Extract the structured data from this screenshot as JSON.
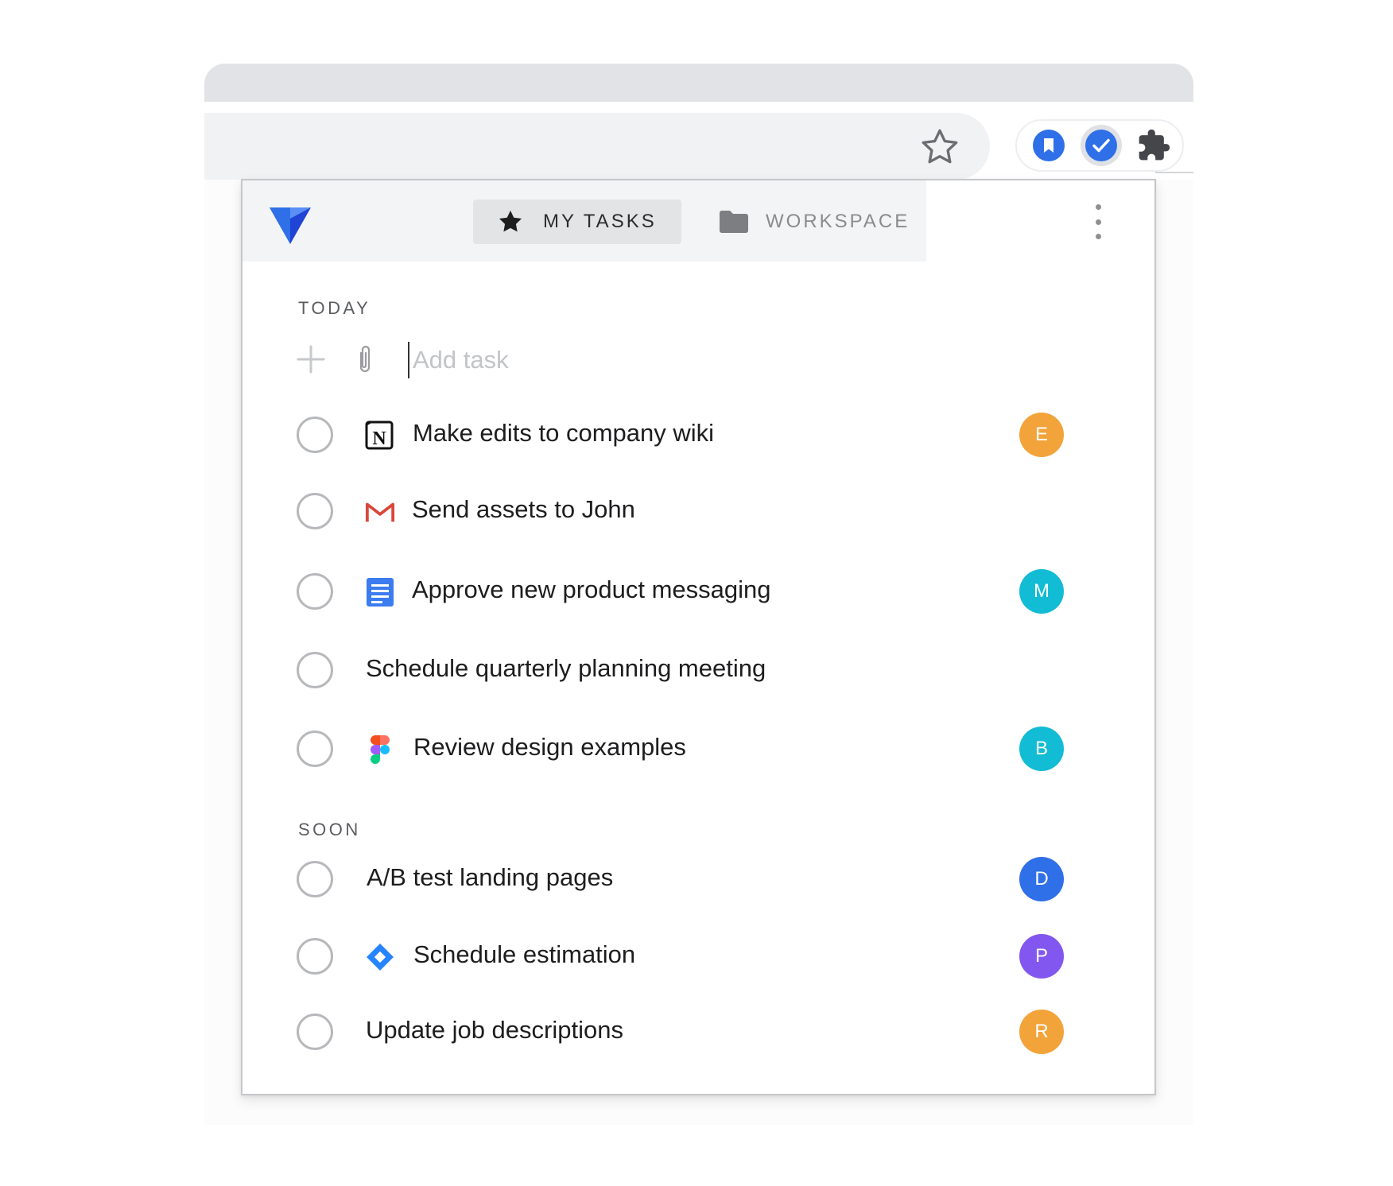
{
  "popup": {
    "tabs": [
      {
        "label": "MY TASKS",
        "icon": "star-icon"
      },
      {
        "label": "WORKSPACE",
        "icon": "folder-icon"
      }
    ],
    "add_task_placeholder": "Add task",
    "sections": [
      {
        "label": "TODAY",
        "tasks": [
          {
            "text": "Make edits to company wiki",
            "app_icon": "notion-icon",
            "assignee": "E",
            "assignee_color": "#f2a33a"
          },
          {
            "text": "Send assets to John",
            "app_icon": "gmail-icon",
            "assignee": "",
            "assignee_color": ""
          },
          {
            "text": "Approve new product messaging",
            "app_icon": "google-docs-icon",
            "assignee": "M",
            "assignee_color": "#12bcd4"
          },
          {
            "text": "Schedule quarterly planning meeting",
            "app_icon": "",
            "assignee": "",
            "assignee_color": ""
          },
          {
            "text": "Review design examples",
            "app_icon": "figma-icon",
            "assignee": "B",
            "assignee_color": "#12bcd4"
          }
        ]
      },
      {
        "label": "SOON",
        "tasks": [
          {
            "text": "A/B test landing pages",
            "app_icon": "",
            "assignee": "D",
            "assignee_color": "#2f6fe8"
          },
          {
            "text": "Schedule estimation",
            "app_icon": "jira-icon",
            "assignee": "P",
            "assignee_color": "#8257f0"
          },
          {
            "text": "Update job descriptions",
            "app_icon": "",
            "assignee": "R",
            "assignee_color": "#f2a33a"
          }
        ]
      }
    ]
  },
  "colors": {
    "accent_blue": "#2f6fe8",
    "check_gray": "#b6b8bb",
    "header_bg": "#f3f4f5"
  }
}
